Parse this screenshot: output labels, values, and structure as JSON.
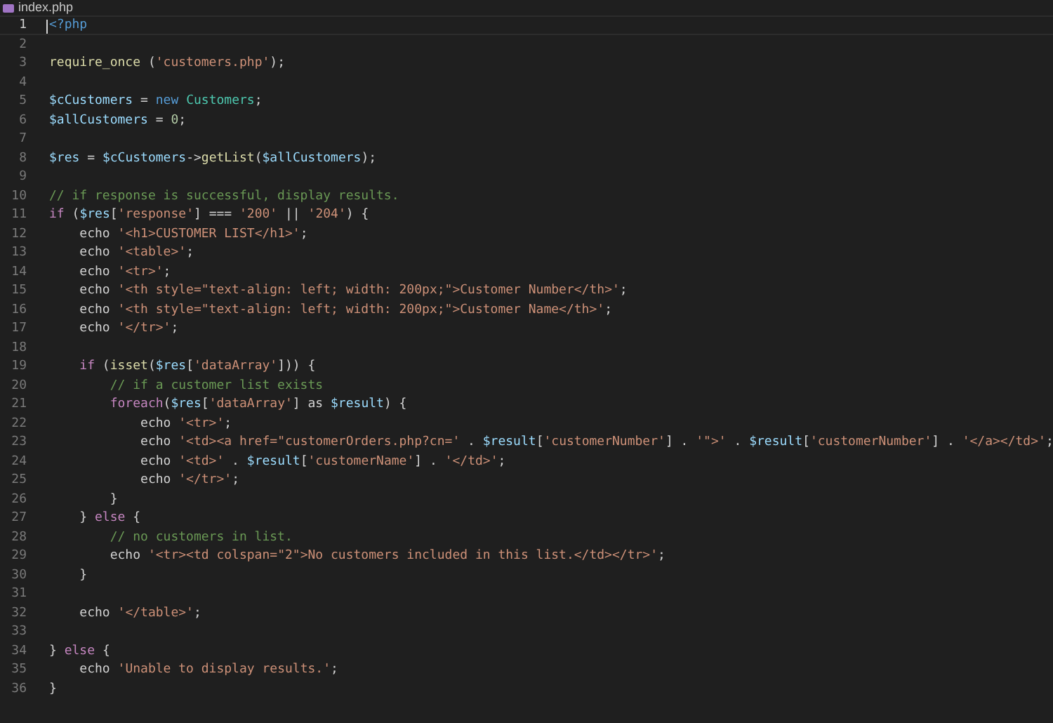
{
  "tab": {
    "title": "index.php"
  },
  "lines": [
    {
      "number": "1",
      "active": true,
      "tokens": [
        {
          "kind": "tag",
          "text": "<?php"
        }
      ]
    },
    {
      "number": "2",
      "active": false
    },
    {
      "number": "3",
      "active": false,
      "tokens": [
        {
          "kind": "function",
          "text": "require_once"
        },
        {
          "kind": "plain",
          "text": " ("
        },
        {
          "kind": "string",
          "text": "'customers.php'"
        },
        {
          "kind": "plain",
          "text": ");"
        }
      ]
    },
    {
      "number": "4",
      "active": false
    },
    {
      "number": "5",
      "active": false,
      "tokens": [
        {
          "kind": "variable",
          "text": "$cCustomers"
        },
        {
          "kind": "plain",
          "text": " = "
        },
        {
          "kind": "storage",
          "text": "new "
        },
        {
          "kind": "class",
          "text": "Customers"
        },
        {
          "kind": "plain",
          "text": ";"
        }
      ]
    },
    {
      "number": "6",
      "active": false,
      "tokens": [
        {
          "kind": "variable",
          "text": "$allCustomers"
        },
        {
          "kind": "plain",
          "text": " = "
        },
        {
          "kind": "number",
          "text": "0"
        },
        {
          "kind": "plain",
          "text": ";"
        }
      ]
    },
    {
      "number": "7",
      "active": false
    },
    {
      "number": "8",
      "active": false,
      "tokens": [
        {
          "kind": "variable",
          "text": "$res"
        },
        {
          "kind": "plain",
          "text": " = "
        },
        {
          "kind": "variable",
          "text": "$cCustomers"
        },
        {
          "kind": "plain",
          "text": "->"
        },
        {
          "kind": "function",
          "text": "getList"
        },
        {
          "kind": "plain",
          "text": "("
        },
        {
          "kind": "variable",
          "text": "$allCustomers"
        },
        {
          "kind": "plain",
          "text": ");"
        }
      ]
    },
    {
      "number": "9",
      "active": false
    },
    {
      "number": "10",
      "active": false,
      "tokens": [
        {
          "kind": "comment",
          "text": "// if response is successful, display results."
        }
      ]
    },
    {
      "number": "11",
      "active": false,
      "tokens": [
        {
          "kind": "keyword",
          "text": "if"
        },
        {
          "kind": "plain",
          "text": " ("
        },
        {
          "kind": "variable",
          "text": "$res"
        },
        {
          "kind": "plain",
          "text": "["
        },
        {
          "kind": "string",
          "text": "'response'"
        },
        {
          "kind": "plain",
          "text": "] === "
        },
        {
          "kind": "string",
          "text": "'200'"
        },
        {
          "kind": "plain",
          "text": " || "
        },
        {
          "kind": "string",
          "text": "'204'"
        },
        {
          "kind": "plain",
          "text": ") {"
        }
      ]
    },
    {
      "number": "12",
      "active": false,
      "tokens": [
        {
          "kind": "plain",
          "text": "    echo "
        },
        {
          "kind": "string",
          "text": "'<h1>CUSTOMER LIST</h1>'"
        },
        {
          "kind": "plain",
          "text": ";"
        }
      ]
    },
    {
      "number": "13",
      "active": false,
      "tokens": [
        {
          "kind": "plain",
          "text": "    echo "
        },
        {
          "kind": "string",
          "text": "'<table>'"
        },
        {
          "kind": "plain",
          "text": ";"
        }
      ]
    },
    {
      "number": "14",
      "active": false,
      "tokens": [
        {
          "kind": "plain",
          "text": "    echo "
        },
        {
          "kind": "string",
          "text": "'<tr>'"
        },
        {
          "kind": "plain",
          "text": ";"
        }
      ]
    },
    {
      "number": "15",
      "active": false,
      "tokens": [
        {
          "kind": "plain",
          "text": "    echo "
        },
        {
          "kind": "string",
          "text": "'<th style=\"text-align: left; width: 200px;\">Customer Number</th>'"
        },
        {
          "kind": "plain",
          "text": ";"
        }
      ]
    },
    {
      "number": "16",
      "active": false,
      "tokens": [
        {
          "kind": "plain",
          "text": "    echo "
        },
        {
          "kind": "string",
          "text": "'<th style=\"text-align: left; width: 200px;\">Customer Name</th>'"
        },
        {
          "kind": "plain",
          "text": ";"
        }
      ]
    },
    {
      "number": "17",
      "active": false,
      "tokens": [
        {
          "kind": "plain",
          "text": "    echo "
        },
        {
          "kind": "string",
          "text": "'</tr>'"
        },
        {
          "kind": "plain",
          "text": ";"
        }
      ]
    },
    {
      "number": "18",
      "active": false
    },
    {
      "number": "19",
      "active": false,
      "tokens": [
        {
          "kind": "keyword",
          "text": "    if"
        },
        {
          "kind": "plain",
          "text": " ("
        },
        {
          "kind": "function",
          "text": "isset"
        },
        {
          "kind": "plain",
          "text": "("
        },
        {
          "kind": "variable",
          "text": "$res"
        },
        {
          "kind": "plain",
          "text": "["
        },
        {
          "kind": "string",
          "text": "'dataArray'"
        },
        {
          "kind": "plain",
          "text": "])) {"
        }
      ]
    },
    {
      "number": "20",
      "active": false,
      "tokens": [
        {
          "kind": "comment",
          "text": "        // if a customer list exists"
        }
      ]
    },
    {
      "number": "21",
      "active": false,
      "tokens": [
        {
          "kind": "keyword",
          "text": "        foreach"
        },
        {
          "kind": "plain",
          "text": "("
        },
        {
          "kind": "variable",
          "text": "$res"
        },
        {
          "kind": "plain",
          "text": "["
        },
        {
          "kind": "string",
          "text": "'dataArray'"
        },
        {
          "kind": "plain",
          "text": "] as "
        },
        {
          "kind": "variable",
          "text": "$result"
        },
        {
          "kind": "plain",
          "text": ") {"
        }
      ]
    },
    {
      "number": "22",
      "active": false,
      "tokens": [
        {
          "kind": "plain",
          "text": "            echo "
        },
        {
          "kind": "string",
          "text": "'<tr>'"
        },
        {
          "kind": "plain",
          "text": ";"
        }
      ]
    },
    {
      "number": "23",
      "active": false,
      "tokens": [
        {
          "kind": "plain",
          "text": "            echo "
        },
        {
          "kind": "string",
          "text": "'<td><a href=\"customerOrders.php?cn='"
        },
        {
          "kind": "plain",
          "text": " . "
        },
        {
          "kind": "variable",
          "text": "$result"
        },
        {
          "kind": "plain",
          "text": "["
        },
        {
          "kind": "string",
          "text": "'customerNumber'"
        },
        {
          "kind": "plain",
          "text": "] . "
        },
        {
          "kind": "string",
          "text": "'\">'"
        },
        {
          "kind": "plain",
          "text": " . "
        },
        {
          "kind": "variable",
          "text": "$result"
        },
        {
          "kind": "plain",
          "text": "["
        },
        {
          "kind": "string",
          "text": "'customerNumber'"
        },
        {
          "kind": "plain",
          "text": "] . "
        },
        {
          "kind": "string",
          "text": "'</a></td>'"
        },
        {
          "kind": "plain",
          "text": ";"
        }
      ]
    },
    {
      "number": "24",
      "active": false,
      "tokens": [
        {
          "kind": "plain",
          "text": "            echo "
        },
        {
          "kind": "string",
          "text": "'<td>'"
        },
        {
          "kind": "plain",
          "text": " . "
        },
        {
          "kind": "variable",
          "text": "$result"
        },
        {
          "kind": "plain",
          "text": "["
        },
        {
          "kind": "string",
          "text": "'customerName'"
        },
        {
          "kind": "plain",
          "text": "] . "
        },
        {
          "kind": "string",
          "text": "'</td>'"
        },
        {
          "kind": "plain",
          "text": ";"
        }
      ]
    },
    {
      "number": "25",
      "active": false,
      "tokens": [
        {
          "kind": "plain",
          "text": "            echo "
        },
        {
          "kind": "string",
          "text": "'</tr>'"
        },
        {
          "kind": "plain",
          "text": ";"
        }
      ]
    },
    {
      "number": "26",
      "active": false,
      "tokens": [
        {
          "kind": "plain",
          "text": "        }"
        }
      ]
    },
    {
      "number": "27",
      "active": false,
      "tokens": [
        {
          "kind": "plain",
          "text": "    } "
        },
        {
          "kind": "keyword",
          "text": "else"
        },
        {
          "kind": "plain",
          "text": " {"
        }
      ]
    },
    {
      "number": "28",
      "active": false,
      "tokens": [
        {
          "kind": "comment",
          "text": "        // no customers in list."
        }
      ]
    },
    {
      "number": "29",
      "active": false,
      "tokens": [
        {
          "kind": "plain",
          "text": "        echo "
        },
        {
          "kind": "string",
          "text": "'<tr><td colspan=\"2\">No customers included in this list.</td></tr>'"
        },
        {
          "kind": "plain",
          "text": ";"
        }
      ]
    },
    {
      "number": "30",
      "active": false,
      "tokens": [
        {
          "kind": "plain",
          "text": "    }"
        }
      ]
    },
    {
      "number": "31",
      "active": false
    },
    {
      "number": "32",
      "active": false,
      "tokens": [
        {
          "kind": "plain",
          "text": "    echo "
        },
        {
          "kind": "string",
          "text": "'</table>'"
        },
        {
          "kind": "plain",
          "text": ";"
        }
      ]
    },
    {
      "number": "33",
      "active": false
    },
    {
      "number": "34",
      "active": false,
      "tokens": [
        {
          "kind": "plain",
          "text": "} "
        },
        {
          "kind": "keyword",
          "text": "else"
        },
        {
          "kind": "plain",
          "text": " {"
        }
      ]
    },
    {
      "number": "35",
      "active": false,
      "tokens": [
        {
          "kind": "plain",
          "text": "    echo "
        },
        {
          "kind": "string",
          "text": "'Unable to display results.'"
        },
        {
          "kind": "plain",
          "text": ";"
        }
      ]
    },
    {
      "number": "36",
      "active": false,
      "tokens": [
        {
          "kind": "plain",
          "text": "}"
        }
      ]
    }
  ]
}
